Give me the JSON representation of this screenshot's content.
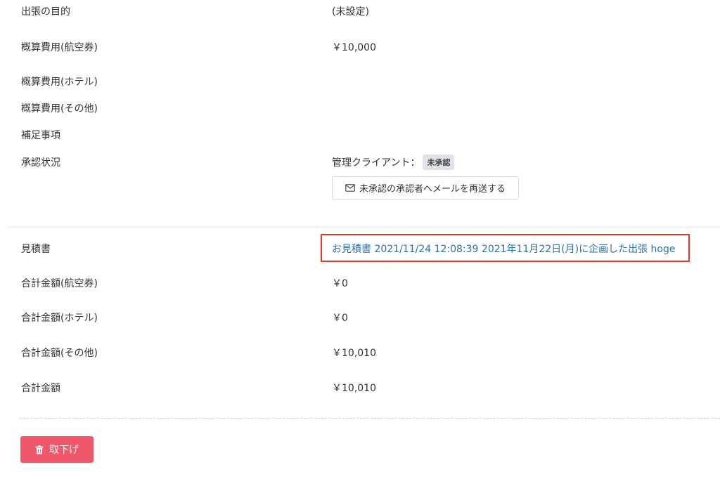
{
  "details": [
    {
      "label": "出張の目的",
      "value": "(未設定)"
    },
    {
      "label": "概算費用(航空券)",
      "value": "￥10,000"
    },
    {
      "label": "概算費用(ホテル)",
      "value": ""
    },
    {
      "label": "概算費用(その他)",
      "value": ""
    },
    {
      "label": "補足事項",
      "value": ""
    },
    {
      "label": "承認状況",
      "value": ""
    }
  ],
  "approval": {
    "approver": "管理クライアント：",
    "badge": "未承認",
    "resend_label": "未承認の承認者へメールを再送する"
  },
  "estimate": {
    "label": "見積書",
    "link_text": "お見積書 2021/11/24 12:08:39 2021年11月22日(月)に企画した出張 hoge"
  },
  "totals": [
    {
      "label": "合計金額(航空券)",
      "value": "￥0"
    },
    {
      "label": "合計金額(ホテル)",
      "value": "￥0"
    },
    {
      "label": "合計金額(その他)",
      "value": "￥10,010"
    },
    {
      "label": "合計金額",
      "value": "￥10,010"
    }
  ],
  "actions": {
    "withdraw_label": "取下げ"
  },
  "colors": {
    "link": "#2a6fb0",
    "highlight": "#e8391f",
    "danger": "#f0576a",
    "badge_bg": "#dfe3e8"
  }
}
